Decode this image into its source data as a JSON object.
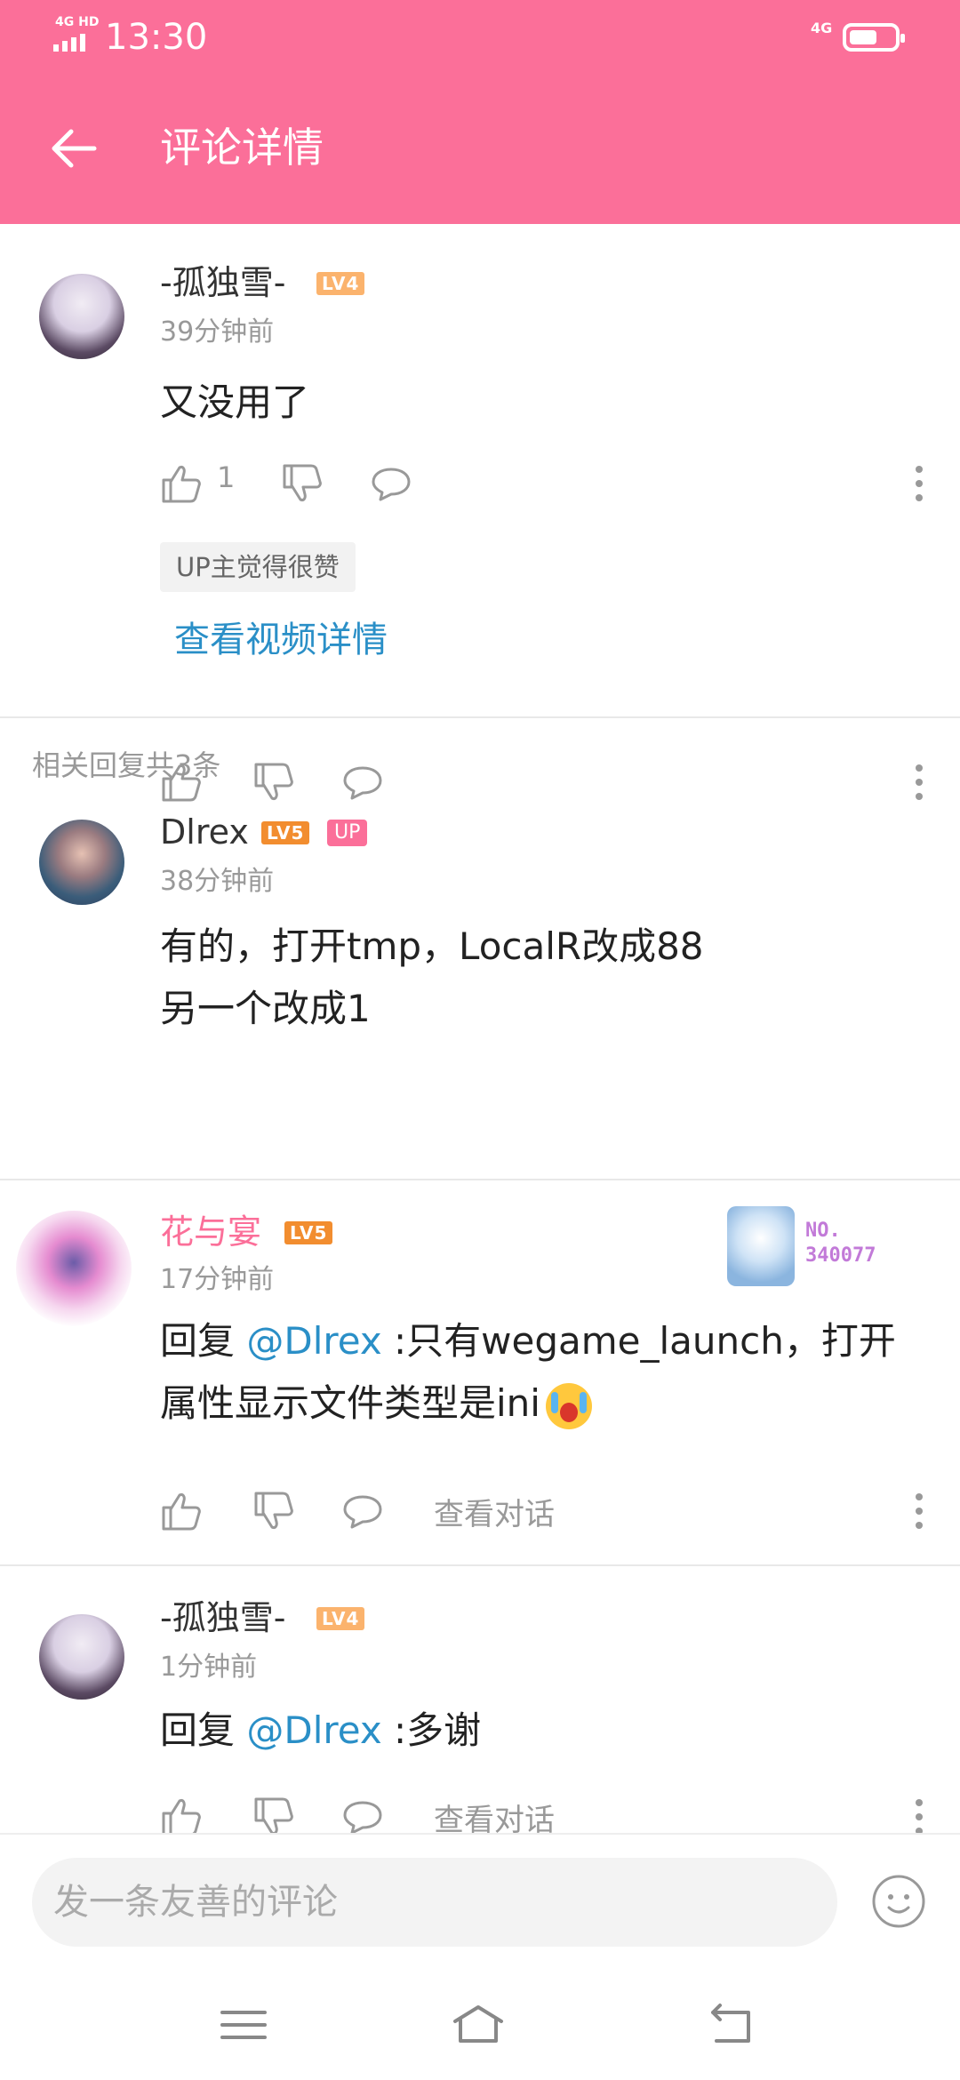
{
  "status_bar": {
    "network": "4G HD",
    "time": "13:30",
    "network_right": "4G"
  },
  "header": {
    "title": "评论详情"
  },
  "main_comment": {
    "user": "-孤独雪-",
    "level": "LV4",
    "time": "39分钟前",
    "text": "又没用了",
    "likes": "1",
    "up_tag": "UP主觉得很赞",
    "view_video": "查看视频详情"
  },
  "replies_header": "相关回复共3条",
  "replies": [
    {
      "user": "Dlrex",
      "level": "LV5",
      "badge": "UP",
      "time": "38分钟前",
      "text_line1": "有的，打开tmp，LocalR改成88",
      "text_line2": "另一个改成1"
    },
    {
      "user": "花与宴",
      "level": "LV5",
      "time": "17分钟前",
      "reply_prefix": "回复 ",
      "mention": "@Dlrex",
      "text_line1": " :只有wegame_launch，打开",
      "text_line2": "属性显示文件类型是ini",
      "view_dialog": "查看对话",
      "medal_no": "NO.",
      "medal_num": "340077"
    },
    {
      "user": "-孤独雪-",
      "level": "LV4",
      "time": "1分钟前",
      "reply_prefix": "回复 ",
      "mention": "@Dlrex",
      "text": " :多谢",
      "view_dialog": "查看对话"
    }
  ],
  "input": {
    "placeholder": "发一条友善的评论"
  },
  "colors": {
    "accent": "#fb6f99",
    "link": "#2a8fc7"
  },
  "icons": [
    "back-arrow-icon",
    "thumbs-up-icon",
    "thumbs-down-icon",
    "comment-bubble-icon",
    "more-icon",
    "emoji-icon",
    "menu-icon",
    "home-icon",
    "return-icon"
  ]
}
